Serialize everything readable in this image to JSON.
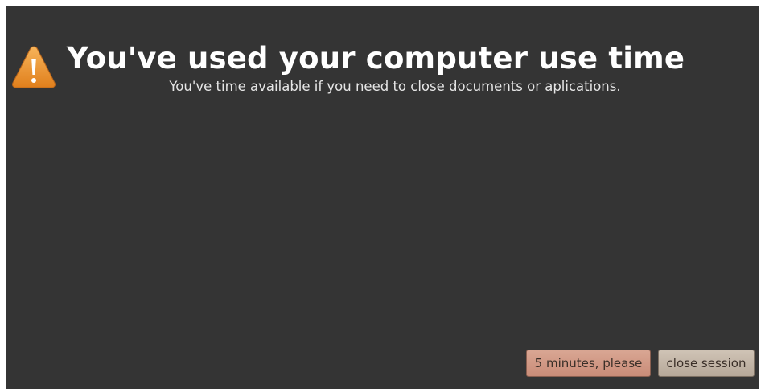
{
  "dialog": {
    "icon": "warning-icon",
    "title": "You've used your computer use time",
    "subtitle": "You've time available if you need to close documents or aplications."
  },
  "buttons": {
    "extend_label": "5 minutes, please",
    "close_label": "close session"
  },
  "colors": {
    "background": "#343434",
    "title_text": "#ffffff",
    "warning_orange": "#f0952f",
    "extend_button": "#d9a693",
    "close_button": "#cfc3b5"
  }
}
